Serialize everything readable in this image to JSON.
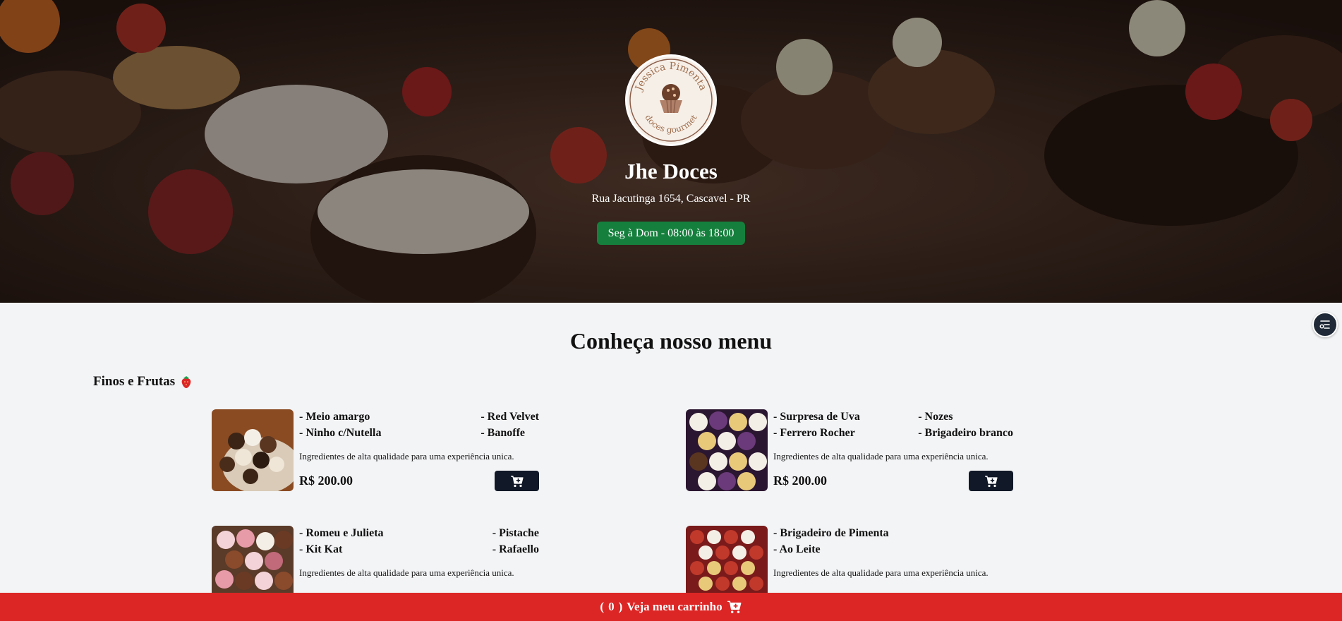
{
  "header": {
    "logo_text_top": "Jessica Pimenta",
    "logo_text_bottom": "doces gourmet",
    "brand_name": "Jhe Doces",
    "address": "Rua Jacutinga 1654, Cascavel - PR",
    "hours": "Seg à Dom - 08:00 às 18:00",
    "hours_color": "#15803d"
  },
  "menu": {
    "title": "Conheça nosso menu",
    "category": {
      "name": "Finos e Frutas",
      "icon": "strawberry-icon"
    },
    "products": [
      {
        "flavors": [
          "- Meio amargo",
          "- Red Velvet",
          "- Ninho c/Nutella",
          "- Banoffe"
        ],
        "description": "Ingredientes de alta qualidade para uma experiência unica.",
        "price": "R$ 200.00"
      },
      {
        "flavors": [
          "- Surpresa de Uva",
          "- Nozes",
          "- Ferrero Rocher",
          "- Brigadeiro branco"
        ],
        "description": "Ingredientes de alta qualidade para uma experiência unica.",
        "price": "R$ 200.00"
      },
      {
        "flavors": [
          "- Romeu e Julieta",
          "- Pistache",
          "- Kit Kat",
          "- Rafaello"
        ],
        "description": "Ingredientes de alta qualidade para uma experiência unica.",
        "price": ""
      },
      {
        "flavors": [
          "- Brigadeiro de Pimenta",
          "",
          "- Ao Leite",
          ""
        ],
        "description": "Ingredientes de alta qualidade para uma experiência unica.",
        "price": ""
      }
    ]
  },
  "cart_bar": {
    "count_open": "(",
    "count": "0",
    "count_close": ")",
    "label": "Veja meu carrinho",
    "color": "#dc2626"
  },
  "icons": {
    "filter": "filter-icon",
    "cart": "cart-plus-icon"
  }
}
